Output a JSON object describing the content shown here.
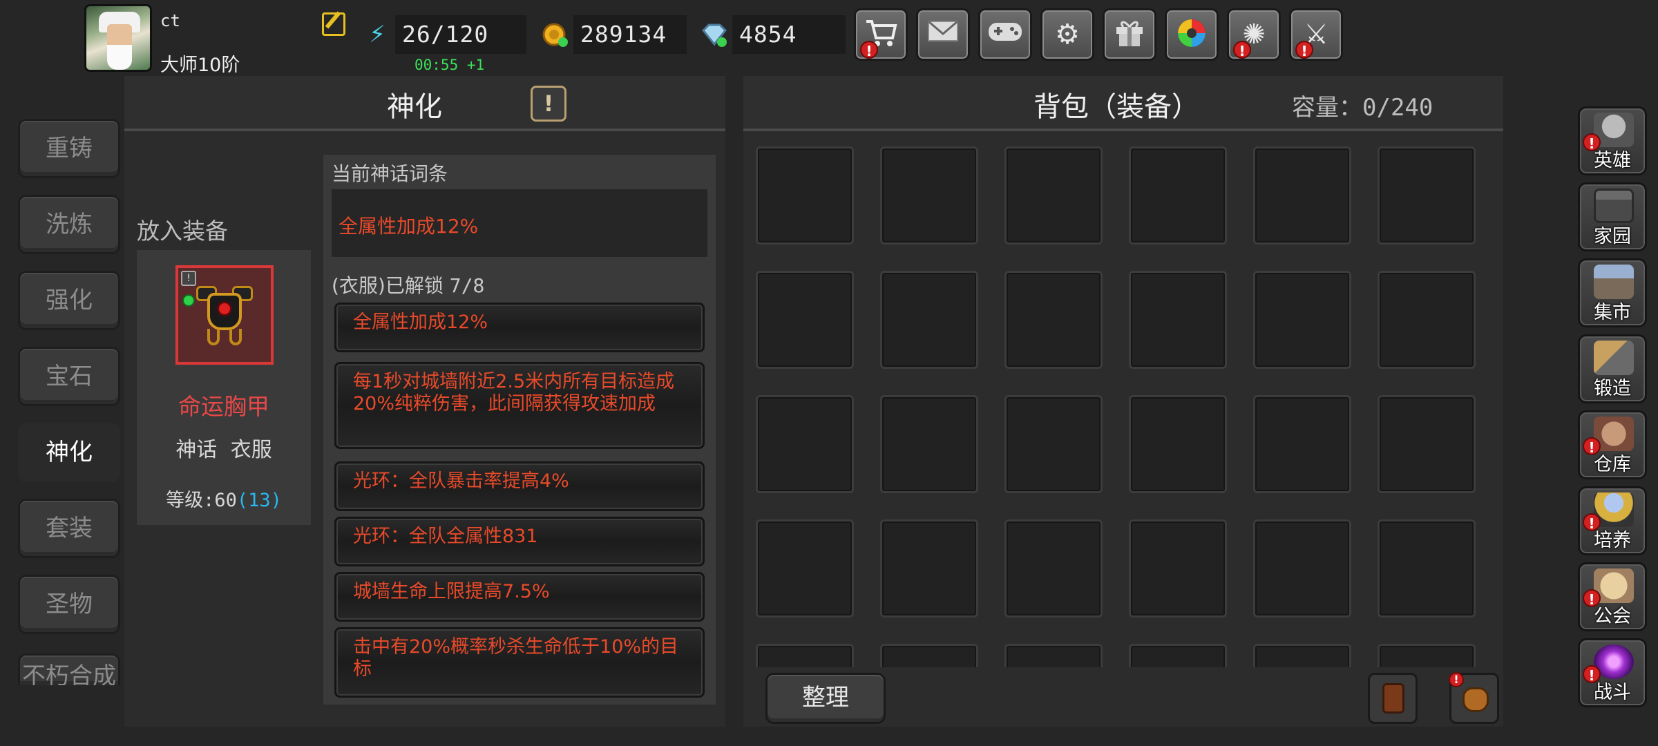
{
  "player": {
    "name": "ct",
    "rank": "大师10阶"
  },
  "resources": {
    "energy": "26/120",
    "energy_timer": "00:55 +1",
    "gold": "289134",
    "gems": "4854"
  },
  "top_buttons": [
    {
      "name": "shop",
      "icon": "cart-icon",
      "alert": true
    },
    {
      "name": "mail",
      "icon": "mail-icon",
      "alert": false
    },
    {
      "name": "gamepad",
      "icon": "gamepad-icon",
      "alert": false
    },
    {
      "name": "settings",
      "icon": "gear-icon",
      "alert": false
    },
    {
      "name": "gift",
      "icon": "gift-icon",
      "alert": false
    },
    {
      "name": "lottery",
      "icon": "color-wheel-icon",
      "alert": false
    },
    {
      "name": "fireworks",
      "icon": "fireworks-icon",
      "alert": true
    },
    {
      "name": "battle",
      "icon": "crossed-swords-icon",
      "alert": true
    }
  ],
  "side_tabs": [
    "重铸",
    "洗炼",
    "强化",
    "宝石",
    "神化",
    "套装",
    "圣物",
    "不朽合成"
  ],
  "active_tab": "神化",
  "mythic": {
    "title": "神化",
    "info_glyph": "!",
    "put_label": "放入装备",
    "equipment": {
      "name": "命运胸甲",
      "rarity": "神话",
      "slot": "衣服",
      "level_label": "等级:",
      "level": "60",
      "level_bonus": "(13)"
    },
    "current_label": "当前神话词条",
    "current_affix": "全属性加成12%",
    "unlock_label": "(衣服)已解锁",
    "unlock_count": "7/8",
    "affixes": [
      "全属性加成12%",
      "每1秒对城墙附近2.5米内所有目标造成20%纯粹伤害，此间隔获得攻速加成",
      "光环：全队暴击率提高4%",
      "光环：全队全属性831",
      "城墙生命上限提高7.5%",
      "击中有20%概率秒杀生命低于10%的目标"
    ]
  },
  "bag": {
    "title": "背包（装备）",
    "capacity_label": "容量：",
    "capacity": "0/240",
    "sort_label": "整理"
  },
  "right_nav": [
    {
      "label": "英雄",
      "icon": "helmet-icon",
      "alert": true
    },
    {
      "label": "家园",
      "icon": "castle-icon",
      "alert": false
    },
    {
      "label": "集市",
      "icon": "market-icon",
      "alert": false
    },
    {
      "label": "锻造",
      "icon": "anvil-icon",
      "alert": false
    },
    {
      "label": "仓库",
      "icon": "warehouse-icon",
      "alert": true
    },
    {
      "label": "培养",
      "icon": "trophy-icon",
      "alert": true
    },
    {
      "label": "公会",
      "icon": "guild-icon",
      "alert": true
    },
    {
      "label": "战斗",
      "icon": "portal-icon",
      "alert": true
    }
  ],
  "colors": {
    "affix_red": "#e84a2a",
    "equip_name_red": "#e84848",
    "timer_green": "#3ce05a",
    "level_bonus_blue": "#2ab8f0"
  }
}
